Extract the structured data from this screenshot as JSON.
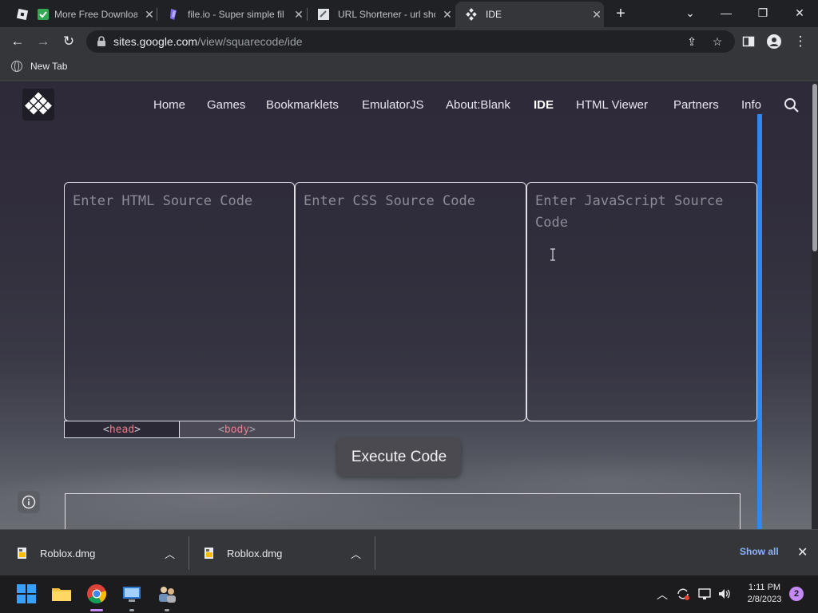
{
  "browser": {
    "tabs": [
      {
        "title": "More Free Downloa",
        "icon": "roblox-icon"
      },
      {
        "title": "file.io - Super simple fil",
        "icon": "fileio-icon"
      },
      {
        "title": "URL Shortener - url sho",
        "icon": "url-shortener-icon"
      },
      {
        "title": "IDE",
        "icon": "squarecode-icon",
        "active": true
      }
    ],
    "url_host": "sites.google.com",
    "url_path": "/view/squarecode/ide",
    "bookmark": "New Tab"
  },
  "site": {
    "nav": [
      "Home",
      "Games",
      "Bookmarklets",
      "EmulatorJS",
      "About:Blank",
      "IDE",
      "HTML Viewer",
      "Partners",
      "Info"
    ],
    "active_nav": "IDE",
    "html_placeholder": "Enter HTML Source Code",
    "css_placeholder": "Enter CSS Source Code",
    "js_placeholder": "Enter JavaScript Source Code",
    "head_tab": {
      "open": "<",
      "tag": "head",
      "close": ">"
    },
    "body_tab": {
      "open": "<",
      "tag": "body",
      "close": ">"
    },
    "execute_label": "Execute Code",
    "accent_color": "#2f87f0"
  },
  "downloads": {
    "items": [
      "Roblox.dmg",
      "Roblox.dmg"
    ],
    "show_all": "Show all"
  },
  "taskbar": {
    "time": "1:11 PM",
    "date": "2/8/2023",
    "notifications": "2"
  }
}
